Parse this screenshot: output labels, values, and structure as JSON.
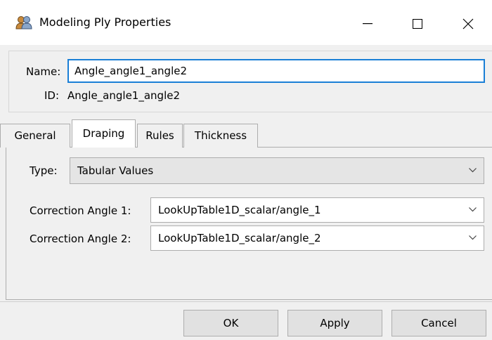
{
  "window": {
    "title": "Modeling Ply Properties",
    "icon": "modeling-ply-icon",
    "controls": [
      "minimize-icon",
      "maximize-icon",
      "close-icon"
    ]
  },
  "header": {
    "name_label": "Name:",
    "name_value": "Angle_angle1_angle2",
    "id_label": "ID:",
    "id_value": "Angle_angle1_angle2"
  },
  "tabs": [
    {
      "label": "General",
      "active": false
    },
    {
      "label": "Draping",
      "active": true
    },
    {
      "label": "Rules",
      "active": false
    },
    {
      "label": "Thickness",
      "active": false
    }
  ],
  "draping": {
    "type_label": "Type:",
    "type_value": "Tabular Values",
    "correction_angle_1_label": "Correction Angle 1:",
    "correction_angle_1_value": "LookUpTable1D_scalar/angle_1",
    "correction_angle_2_label": "Correction Angle 2:",
    "correction_angle_2_value": "LookUpTable1D_scalar/angle_2"
  },
  "buttons": {
    "ok": "OK",
    "apply": "Apply",
    "cancel": "Cancel"
  },
  "colors": {
    "focus_border": "#1a7fd6",
    "background": "#f0f0f0"
  }
}
